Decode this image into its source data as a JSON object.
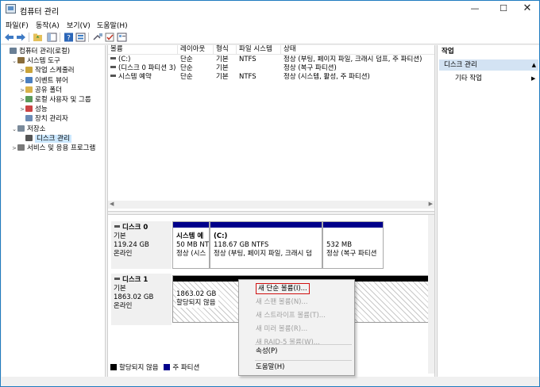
{
  "window": {
    "title": "컴퓨터 관리"
  },
  "menubar": [
    "파일(F)",
    "동작(A)",
    "보기(V)",
    "도움말(H)"
  ],
  "tree": [
    {
      "label": "컴퓨터 관리(로컬)",
      "indent": 0,
      "arrow": "",
      "icon": "computer-icon",
      "color": "#6a7f95"
    },
    {
      "label": "시스템 도구",
      "indent": 1,
      "arrow": "⌄",
      "icon": "tools-icon",
      "color": "#8a6d3b"
    },
    {
      "label": "작업 스케줄러",
      "indent": 2,
      "arrow": ">",
      "icon": "clock-icon",
      "color": "#c9a43a"
    },
    {
      "label": "이벤트 뷰어",
      "indent": 2,
      "arrow": ">",
      "icon": "event-viewer-icon",
      "color": "#4b7fbf"
    },
    {
      "label": "공유 폴더",
      "indent": 2,
      "arrow": ">",
      "icon": "shared-folder-icon",
      "color": "#d8b24a"
    },
    {
      "label": "로컬 사용자 및 그룹",
      "indent": 2,
      "arrow": ">",
      "icon": "users-icon",
      "color": "#5a9a5a"
    },
    {
      "label": "성능",
      "indent": 2,
      "arrow": ">",
      "icon": "performance-icon",
      "color": "#cc4444"
    },
    {
      "label": "장치 관리자",
      "indent": 2,
      "arrow": "",
      "icon": "device-manager-icon",
      "color": "#6b8bb5"
    },
    {
      "label": "저장소",
      "indent": 1,
      "arrow": "⌄",
      "icon": "storage-icon",
      "color": "#7a8a9a"
    },
    {
      "label": "디스크 관리",
      "indent": 2,
      "arrow": "",
      "icon": "disk-icon",
      "color": "#555555",
      "selected": true
    },
    {
      "label": "서비스 및 응용 프로그램",
      "indent": 1,
      "arrow": ">",
      "icon": "services-icon",
      "color": "#7a7a7a"
    }
  ],
  "volume_list": {
    "headers": [
      "볼륨",
      "레이아웃",
      "형식",
      "파일 시스템",
      "상태"
    ],
    "rows": [
      [
        "(C:)",
        "단순",
        "기본",
        "NTFS",
        "정상 (부팅, 페이지 파일, 크래시 덤프, 주 파티션)"
      ],
      [
        "(디스크 0 파티션 3)",
        "단순",
        "기본",
        "",
        "정상 (복구 파티션)"
      ],
      [
        "시스템 예약",
        "단순",
        "기본",
        "NTFS",
        "정상 (시스템, 활성, 주 파티션)"
      ]
    ]
  },
  "disks": [
    {
      "name": "디스크 0",
      "type": "기본",
      "size": "119.24 GB",
      "status": "온라인",
      "partitions": [
        {
          "name": "시스템 예",
          "size": "50 MB NT",
          "status": "정상 (시스"
        },
        {
          "name": "(C:)",
          "size": "118.67 GB NTFS",
          "status": "정상 (부팅, 페이지 파일, 크래시 덤"
        },
        {
          "name": "",
          "size": "532 MB",
          "status": "정상 (복구 파티션"
        }
      ]
    },
    {
      "name": "디스크 1",
      "type": "기본",
      "size": "1863.02 GB",
      "status": "온라인",
      "unallocated": {
        "size": "1863.02 GB",
        "label": "할당되지 않음"
      }
    }
  ],
  "legend": {
    "unallocated": "할당되지 않음",
    "primary": "주 파티션"
  },
  "context_menu": [
    {
      "label": "새 단순 볼륨(I)...",
      "enabled": true,
      "highlight": true
    },
    {
      "label": "새 스팬 볼륨(N)...",
      "enabled": false
    },
    {
      "label": "새 스트라이프 볼륨(T)...",
      "enabled": false
    },
    {
      "label": "새 미러 볼륨(R)...",
      "enabled": false
    },
    {
      "label": "새 RAID-5 볼륨(W)...",
      "enabled": false
    },
    {
      "label": "속성(P)",
      "enabled": true
    },
    {
      "label": "도움말(H)",
      "enabled": true
    }
  ],
  "actions": {
    "header": "작업",
    "section": "디스크 관리",
    "item": "기타 작업"
  },
  "colors": {
    "primary_partition": "#00008b",
    "unallocated": "#000000",
    "selection": "#cce8ff",
    "highlight_border": "#d01010"
  }
}
